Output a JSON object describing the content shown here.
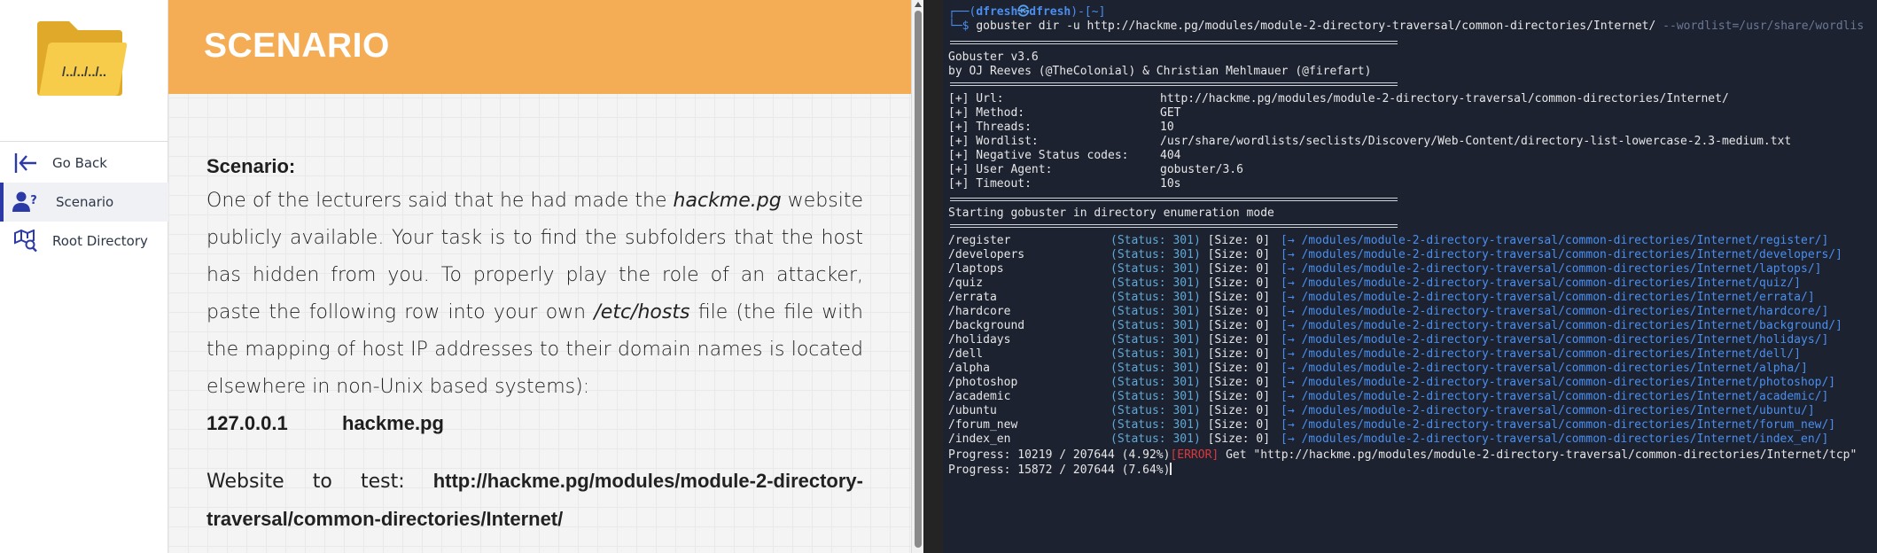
{
  "sidebar": {
    "logo_text": "/../../../..",
    "items": [
      {
        "label": "Go Back",
        "icon": "arrow-left-bar-icon"
      },
      {
        "label": "Scenario",
        "icon": "user-question-icon",
        "active": true
      },
      {
        "label": "Root Directory",
        "icon": "map-search-icon"
      }
    ]
  },
  "header": {
    "title": "SCENARIO"
  },
  "content": {
    "heading": "Scenario:",
    "para_part1": "One of the lecturers said that he had made the ",
    "para_italic1": "hackme.pg",
    "para_part2": " website publicly available. Your task is to find the subfolders that the host has hidden from you. To properly play the role of an attacker, paste the following row into your own ",
    "para_italic2": "/etc/hosts",
    "para_part3": " file (the file with the mapping of host IP addresses to their domain names is located elsewhere in non-Unix based systems):",
    "hosts_ip": "127.0.0.1",
    "hosts_name": "hackme.pg",
    "website_label": "Website to test: ",
    "website_url": "http://hackme.pg/modules/module-2-directory-traversal/common-directories/Internet/"
  },
  "terminal": {
    "prompt_prefix": "┌──(",
    "prompt_user": "dfresh",
    "prompt_skull": "㉿",
    "prompt_host": "dfresh",
    "prompt_suffix": ")-[~]",
    "prompt_line2": "└─$ ",
    "command": "gobuster",
    "command_args": " dir -u http://hackme.pg/modules/module-2-directory-traversal/common-directories/Internet/ ",
    "command_wordlist": "--wordlist=/usr/share/wordlis",
    "banner_version": "Gobuster v3.6",
    "banner_authors": "by OJ Reeves (@TheColonial) & Christian Mehlmauer (@firefart)",
    "config": [
      {
        "key": "[+] Url:",
        "value": "http://hackme.pg/modules/module-2-directory-traversal/common-directories/Internet/"
      },
      {
        "key": "[+] Method:",
        "value": "GET"
      },
      {
        "key": "[+] Threads:",
        "value": "10"
      },
      {
        "key": "[+] Wordlist:",
        "value": "/usr/share/wordlists/seclists/Discovery/Web-Content/directory-list-lowercase-2.3-medium.txt"
      },
      {
        "key": "[+] Negative Status codes:",
        "value": "404"
      },
      {
        "key": "[+] User Agent:",
        "value": "gobuster/3.6"
      },
      {
        "key": "[+] Timeout:",
        "value": "10s"
      }
    ],
    "starting": "Starting gobuster in directory enumeration mode",
    "results": [
      {
        "path": "/register",
        "status": "301",
        "size": "0",
        "redirect": "/modules/module-2-directory-traversal/common-directories/Internet/register/]"
      },
      {
        "path": "/developers",
        "status": "301",
        "size": "0",
        "redirect": "/modules/module-2-directory-traversal/common-directories/Internet/developers/]"
      },
      {
        "path": "/laptops",
        "status": "301",
        "size": "0",
        "redirect": "/modules/module-2-directory-traversal/common-directories/Internet/laptops/]"
      },
      {
        "path": "/quiz",
        "status": "301",
        "size": "0",
        "redirect": "/modules/module-2-directory-traversal/common-directories/Internet/quiz/]"
      },
      {
        "path": "/errata",
        "status": "301",
        "size": "0",
        "redirect": "/modules/module-2-directory-traversal/common-directories/Internet/errata/]"
      },
      {
        "path": "/hardcore",
        "status": "301",
        "size": "0",
        "redirect": "/modules/module-2-directory-traversal/common-directories/Internet/hardcore/]"
      },
      {
        "path": "/background",
        "status": "301",
        "size": "0",
        "redirect": "/modules/module-2-directory-traversal/common-directories/Internet/background/]"
      },
      {
        "path": "/holidays",
        "status": "301",
        "size": "0",
        "redirect": "/modules/module-2-directory-traversal/common-directories/Internet/holidays/]"
      },
      {
        "path": "/dell",
        "status": "301",
        "size": "0",
        "redirect": "/modules/module-2-directory-traversal/common-directories/Internet/dell/]"
      },
      {
        "path": "/alpha",
        "status": "301",
        "size": "0",
        "redirect": "/modules/module-2-directory-traversal/common-directories/Internet/alpha/]"
      },
      {
        "path": "/photoshop",
        "status": "301",
        "size": "0",
        "redirect": "/modules/module-2-directory-traversal/common-directories/Internet/photoshop/]"
      },
      {
        "path": "/academic",
        "status": "301",
        "size": "0",
        "redirect": "/modules/module-2-directory-traversal/common-directories/Internet/academic/]"
      },
      {
        "path": "/ubuntu",
        "status": "301",
        "size": "0",
        "redirect": "/modules/module-2-directory-traversal/common-directories/Internet/ubuntu/]"
      },
      {
        "path": "/forum_new",
        "status": "301",
        "size": "0",
        "redirect": "/modules/module-2-directory-traversal/common-directories/Internet/forum_new/]"
      },
      {
        "path": "/index_en",
        "status": "301",
        "size": "0",
        "redirect": "/modules/module-2-directory-traversal/common-directories/Internet/index_en/]"
      }
    ],
    "progress1_prefix": "Progress: 10219 / 207644 (4.92%)",
    "progress1_error": "[ERROR]",
    "progress1_suffix": " Get \"http://hackme.pg/modules/module-2-directory-traversal/common-directories/Internet/tcp\"",
    "progress2": "Progress: 15872 / 207644 (7.64%)"
  },
  "colors": {
    "header": "#f4ad55",
    "accent": "#2c3aa8",
    "terminal_bg": "#1c2230",
    "terminal_blue": "#4a8ff0",
    "terminal_red": "#e0373b"
  }
}
